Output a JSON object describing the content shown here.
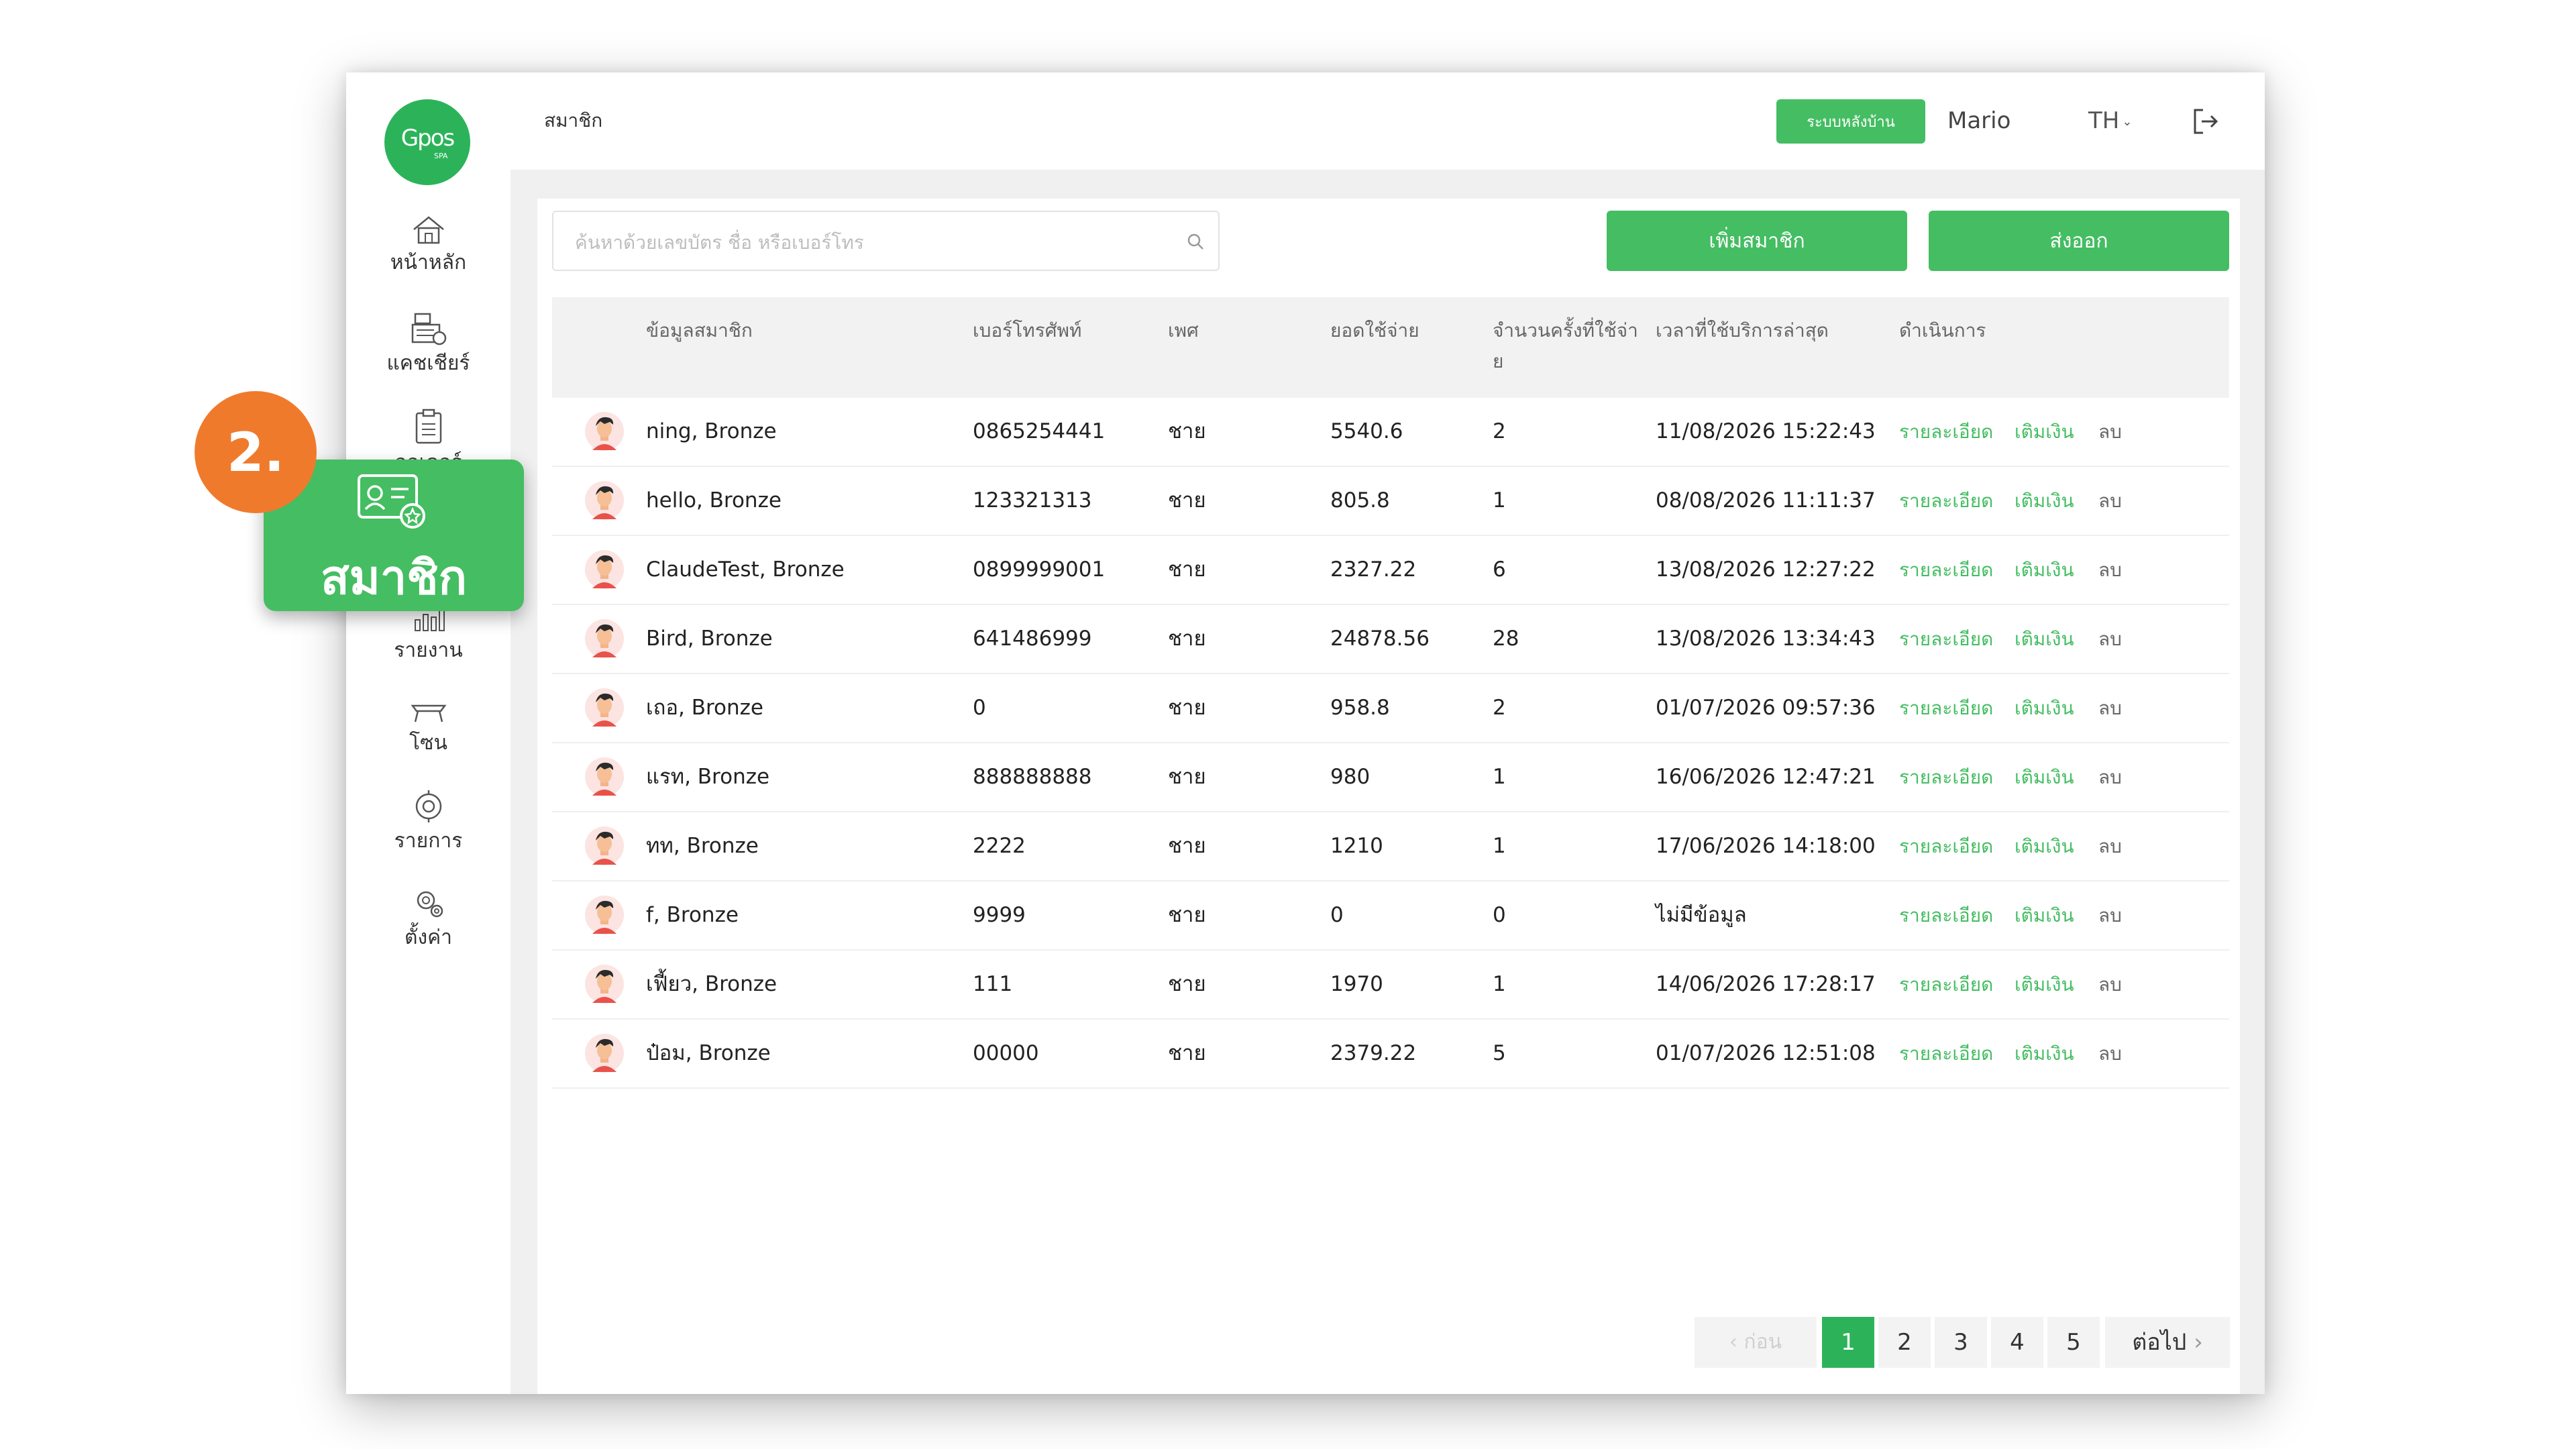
{
  "header": {
    "page_title": "สมาชิก",
    "backoffice_label": "ระบบหลังบ้าน",
    "user_name": "Mario",
    "language": "TH"
  },
  "logo": {
    "text": "Gpos",
    "sub": "SPA"
  },
  "sidebar": {
    "items": [
      {
        "label": "หน้าหลัก",
        "icon": "home-icon"
      },
      {
        "label": "แคชเชียร์",
        "icon": "cash-register-icon"
      },
      {
        "label": "ออเดอร์",
        "icon": "clipboard-icon"
      },
      {
        "label": "สมาชิก",
        "icon": "member-card-icon"
      },
      {
        "label": "รายงาน",
        "icon": "report-chart-icon"
      },
      {
        "label": "โซน",
        "icon": "zone-bed-icon"
      },
      {
        "label": "รายการ",
        "icon": "service-list-icon"
      },
      {
        "label": "ตั้งค่า",
        "icon": "gear-icon"
      }
    ]
  },
  "toolbar": {
    "search_placeholder": "ค้นหาด้วยเลขบัตร ชื่อ หรือเบอร์โทร",
    "add_label": "เพิ่มสมาชิก",
    "export_label": "ส่งออก"
  },
  "table": {
    "headers": {
      "member_info": "ข้อมูลสมาชิก",
      "phone": "เบอร์โทรศัพท์",
      "gender": "เพศ",
      "spending": "ยอดใช้จ่าย",
      "visits_line1": "จำนวนครั้งที่ใช้จ่า",
      "visits_line2": "ย",
      "last_service": "เวลาที่ใช้บริการล่าสุด",
      "actions": "ดำเนินการ"
    },
    "actions": {
      "detail": "รายละเอียด",
      "topup": "เติมเงิน",
      "delete": "ลบ"
    },
    "rows": [
      {
        "name": "ning, Bronze",
        "phone": "0865254441",
        "gender": "ชาย",
        "spending": "5540.6",
        "visits": "2",
        "last": "11/08/2026 15:22:43"
      },
      {
        "name": "hello, Bronze",
        "phone": "123321313",
        "gender": "ชาย",
        "spending": "805.8",
        "visits": "1",
        "last": "08/08/2026 11:11:37"
      },
      {
        "name": "ClaudeTest, Bronze",
        "phone": "0899999001",
        "gender": "ชาย",
        "spending": "2327.22",
        "visits": "6",
        "last": "13/08/2026 12:27:22"
      },
      {
        "name": "Bird, Bronze",
        "phone": "641486999",
        "gender": "ชาย",
        "spending": "24878.56",
        "visits": "28",
        "last": "13/08/2026 13:34:43"
      },
      {
        "name": "เถอ, Bronze",
        "phone": "0",
        "gender": "ชาย",
        "spending": "958.8",
        "visits": "2",
        "last": "01/07/2026 09:57:36"
      },
      {
        "name": "แรท, Bronze",
        "phone": "888888888",
        "gender": "ชาย",
        "spending": "980",
        "visits": "1",
        "last": "16/06/2026 12:47:21"
      },
      {
        "name": "ทท, Bronze",
        "phone": "2222",
        "gender": "ชาย",
        "spending": "1210",
        "visits": "1",
        "last": "17/06/2026 14:18:00"
      },
      {
        "name": "f, Bronze",
        "phone": "9999",
        "gender": "ชาย",
        "spending": "0",
        "visits": "0",
        "last": "ไม่มีข้อมูล"
      },
      {
        "name": "เฟี้ยว, Bronze",
        "phone": "111",
        "gender": "ชาย",
        "spending": "1970",
        "visits": "1",
        "last": "14/06/2026 17:28:17"
      },
      {
        "name": "ป๋อม, Bronze",
        "phone": "00000",
        "gender": "ชาย",
        "spending": "2379.22",
        "visits": "5",
        "last": "01/07/2026 12:51:08"
      }
    ]
  },
  "pagination": {
    "prev_label": "ก่อน",
    "pages": [
      "1",
      "2",
      "3",
      "4",
      "5"
    ],
    "current_page": "1",
    "next_label": "ต่อไป"
  },
  "callout": {
    "step": "2.",
    "label": "สมาชิก"
  },
  "colors": {
    "brand_green": "#45bd62",
    "callout_orange": "#f07a2c"
  }
}
